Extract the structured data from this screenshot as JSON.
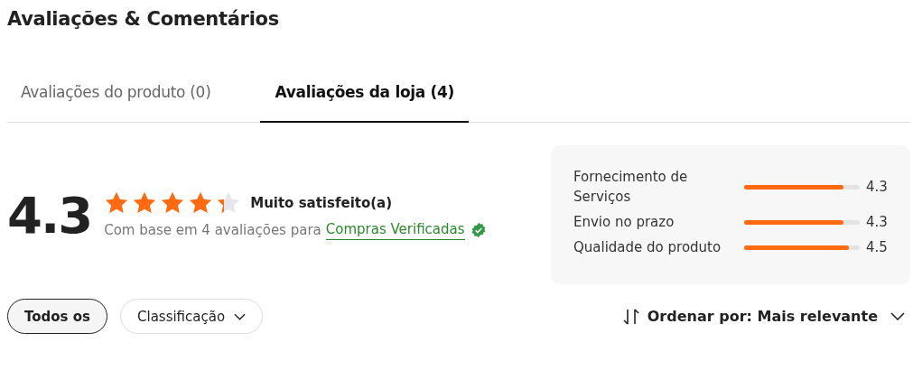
{
  "title": "Avaliações & Comentários",
  "tabs": [
    {
      "label": "Avaliações do produto (0)",
      "selected": false
    },
    {
      "label": "Avaliações da loja (4)",
      "selected": true
    }
  ],
  "summary": {
    "score": "4.3",
    "stars": 4.3,
    "verdict": "Muito satisfeito(a)",
    "basis": "Com base em 4 avaliações para",
    "verified_link": "Compras Verificadas"
  },
  "metrics": [
    {
      "label": "Fornecimento de Serviços",
      "level": 0.86,
      "value": "4.3"
    },
    {
      "label": "Envio no prazo",
      "level": 0.86,
      "value": "4.3"
    },
    {
      "label": "Qualidade do produto",
      "level": 0.91,
      "value": "4.5"
    }
  ],
  "filters": [
    {
      "label": "Todos os",
      "selected": true,
      "kind": "chip"
    },
    {
      "label": "Classificação",
      "selected": false,
      "kind": "dropdown"
    }
  ],
  "sort": {
    "label": "Ordenar por: Mais relevante"
  }
}
